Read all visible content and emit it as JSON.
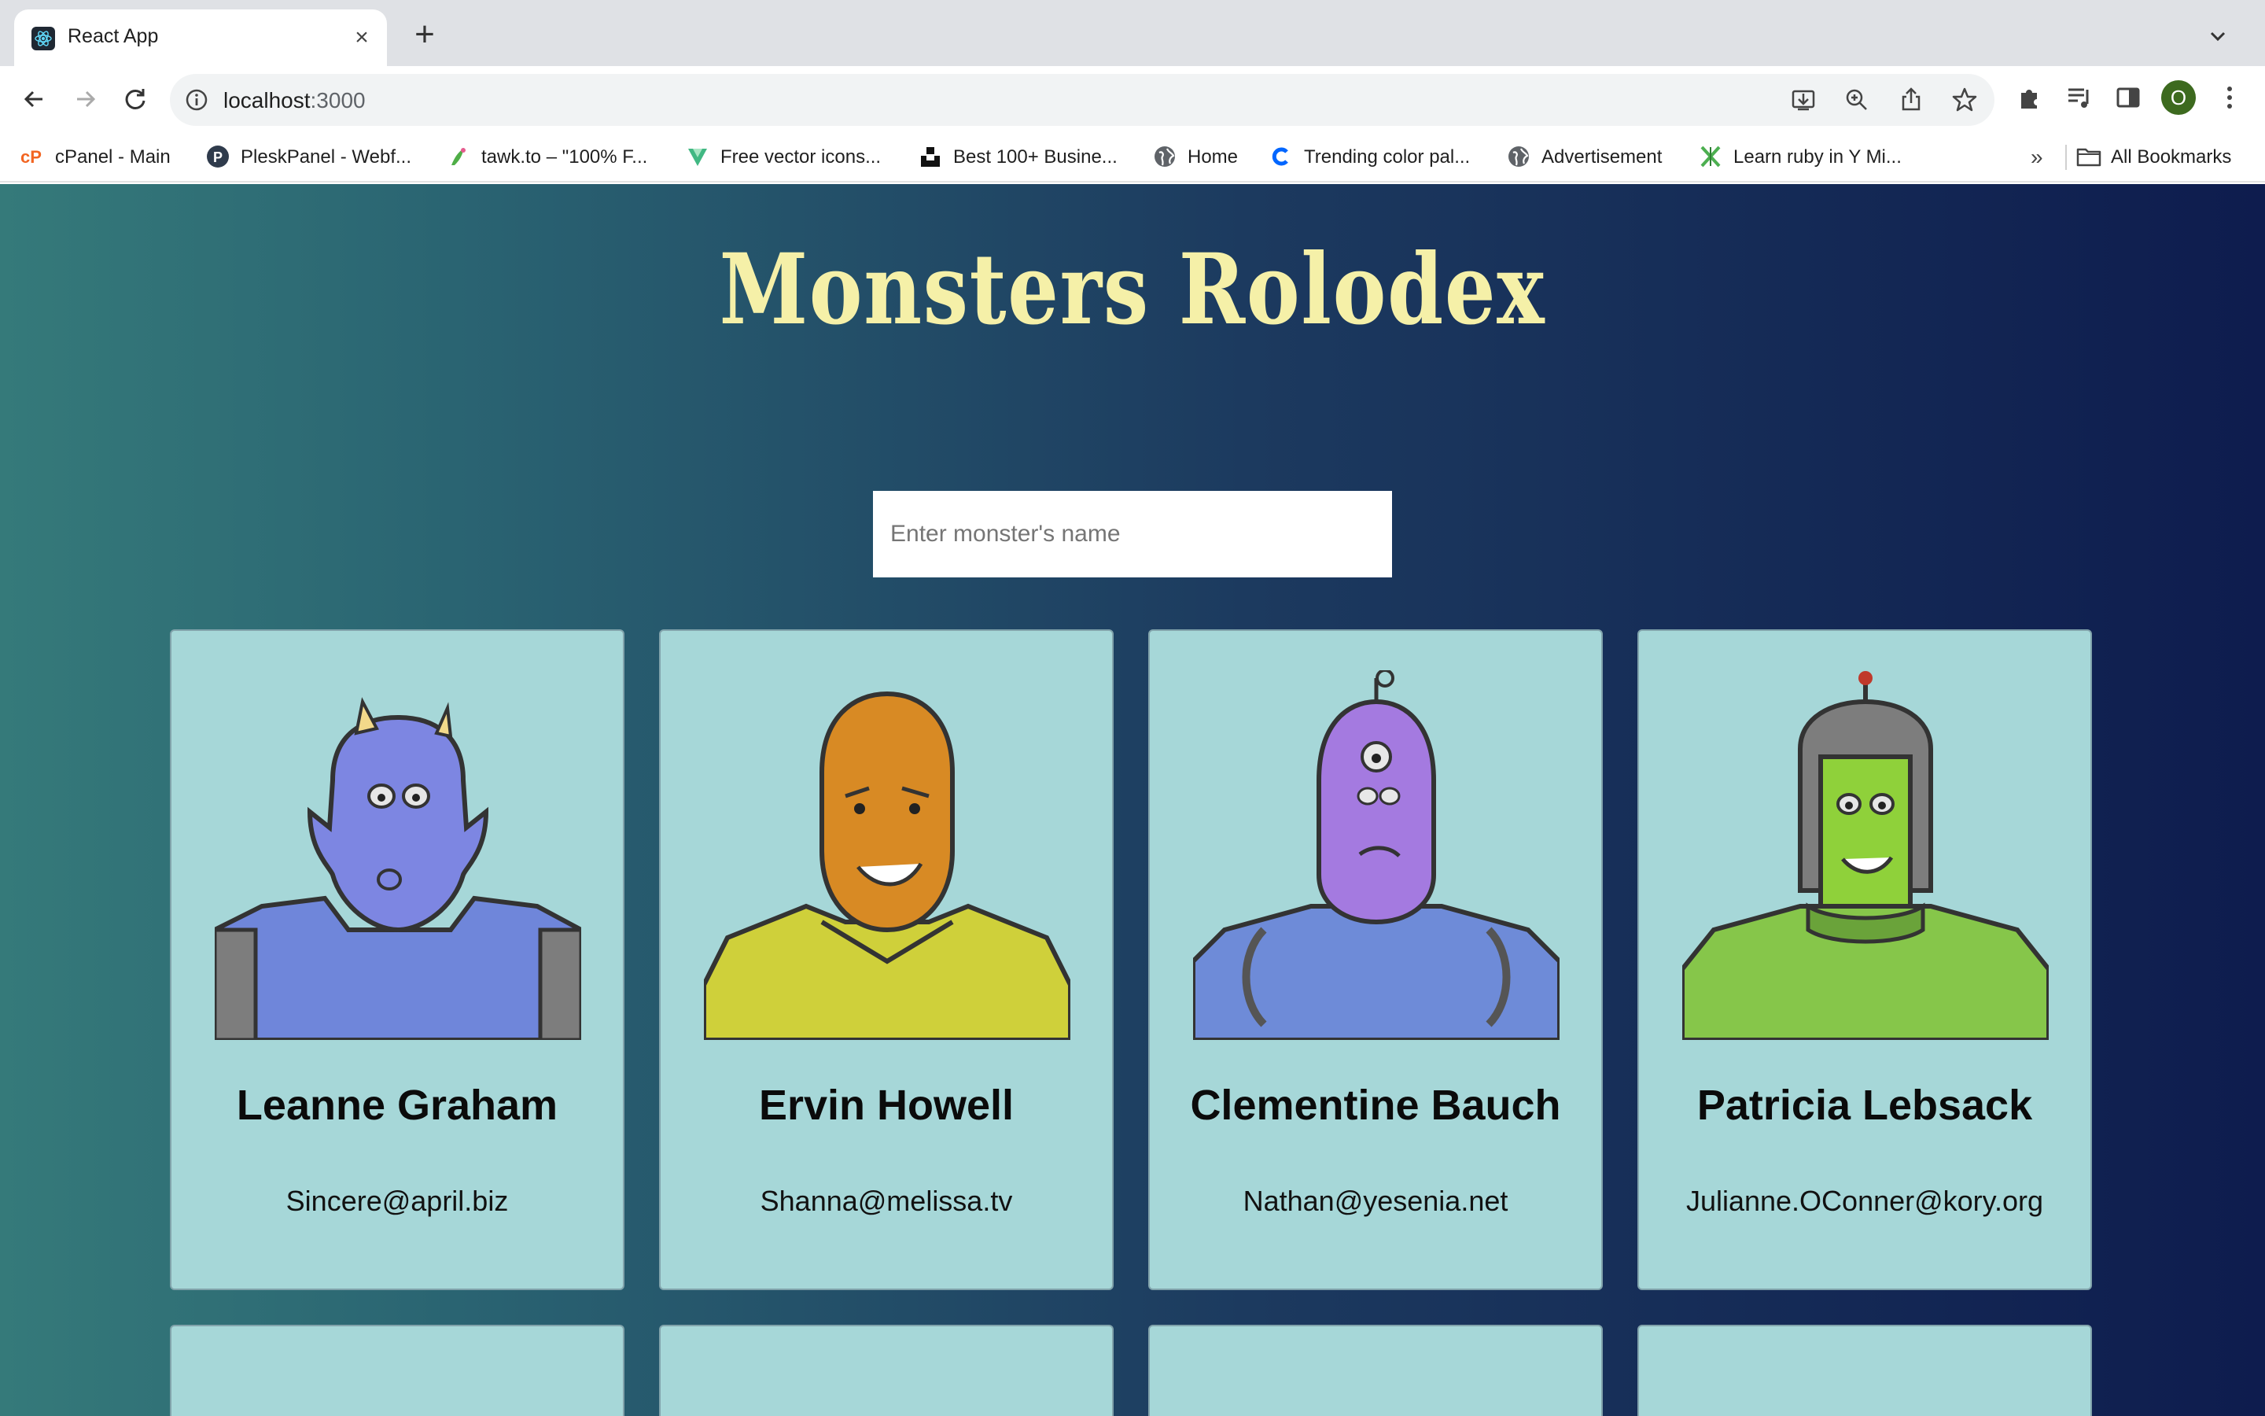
{
  "browser": {
    "tab_title": "React App",
    "url_host": "localhost",
    "url_port": ":3000",
    "profile_initial": "O",
    "bookmarks": [
      {
        "label": "cPanel - Main",
        "icon": "cpanel-icon"
      },
      {
        "label": "PleskPanel - Webf...",
        "icon": "plesk-icon"
      },
      {
        "label": "tawk.to – \"100% F...",
        "icon": "tawk-icon"
      },
      {
        "label": "Free vector icons...",
        "icon": "vector-icon"
      },
      {
        "label": "Best 100+ Busine...",
        "icon": "unsplash-icon"
      },
      {
        "label": "Home",
        "icon": "globe-icon"
      },
      {
        "label": "Trending color pal...",
        "icon": "coolors-icon"
      },
      {
        "label": "Advertisement",
        "icon": "globe-icon"
      },
      {
        "label": "Learn ruby in Y Mi...",
        "icon": "x-icon"
      }
    ],
    "more_bookmarks": "»",
    "all_bookmarks": "All Bookmarks"
  },
  "app": {
    "title": "Monsters Rolodex",
    "search_placeholder": "Enter monster's name",
    "monsters": [
      {
        "name": "Leanne Graham",
        "email": "Sincere@april.biz",
        "color": "#7a83e0"
      },
      {
        "name": "Ervin Howell",
        "email": "Shanna@melissa.tv",
        "color": "#d48a2a"
      },
      {
        "name": "Clementine Bauch",
        "email": "Nathan@yesenia.net",
        "color": "#a57ae0"
      },
      {
        "name": "Patricia Lebsack",
        "email": "Julianne.OConner@kory.org",
        "color": "#8fd13a"
      }
    ]
  },
  "colors": {
    "title": "#f5f0a8",
    "card": "#a6d7d8"
  }
}
